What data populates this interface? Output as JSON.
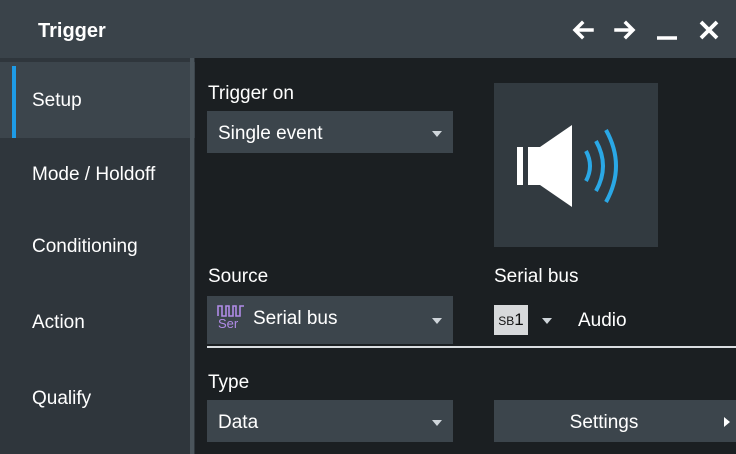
{
  "window": {
    "title": "Trigger"
  },
  "titlebar_icons": [
    "arrow-left-icon",
    "arrow-right-icon",
    "minimize-icon",
    "close-icon"
  ],
  "sidebar": {
    "items": [
      {
        "label": "Setup",
        "active": true
      },
      {
        "label": "Mode / Holdoff",
        "active": false
      },
      {
        "label": "Conditioning",
        "active": false
      },
      {
        "label": "Action",
        "active": false
      },
      {
        "label": "Qualify",
        "active": false
      }
    ]
  },
  "trigger_on": {
    "label": "Trigger on",
    "value": "Single event"
  },
  "source": {
    "label": "Source",
    "value": "Serial bus",
    "icon_text": "Ser"
  },
  "serial_bus": {
    "label": "Serial bus",
    "badge_prefix": "SB",
    "badge_number": "1",
    "name": "Audio"
  },
  "type": {
    "label": "Type",
    "value": "Data"
  },
  "settings_button": {
    "label": "Settings"
  },
  "colors": {
    "accent": "#1e9be6",
    "panel": "#3c454c",
    "background": "#1b1f22",
    "serial_icon": "#b08be6"
  }
}
